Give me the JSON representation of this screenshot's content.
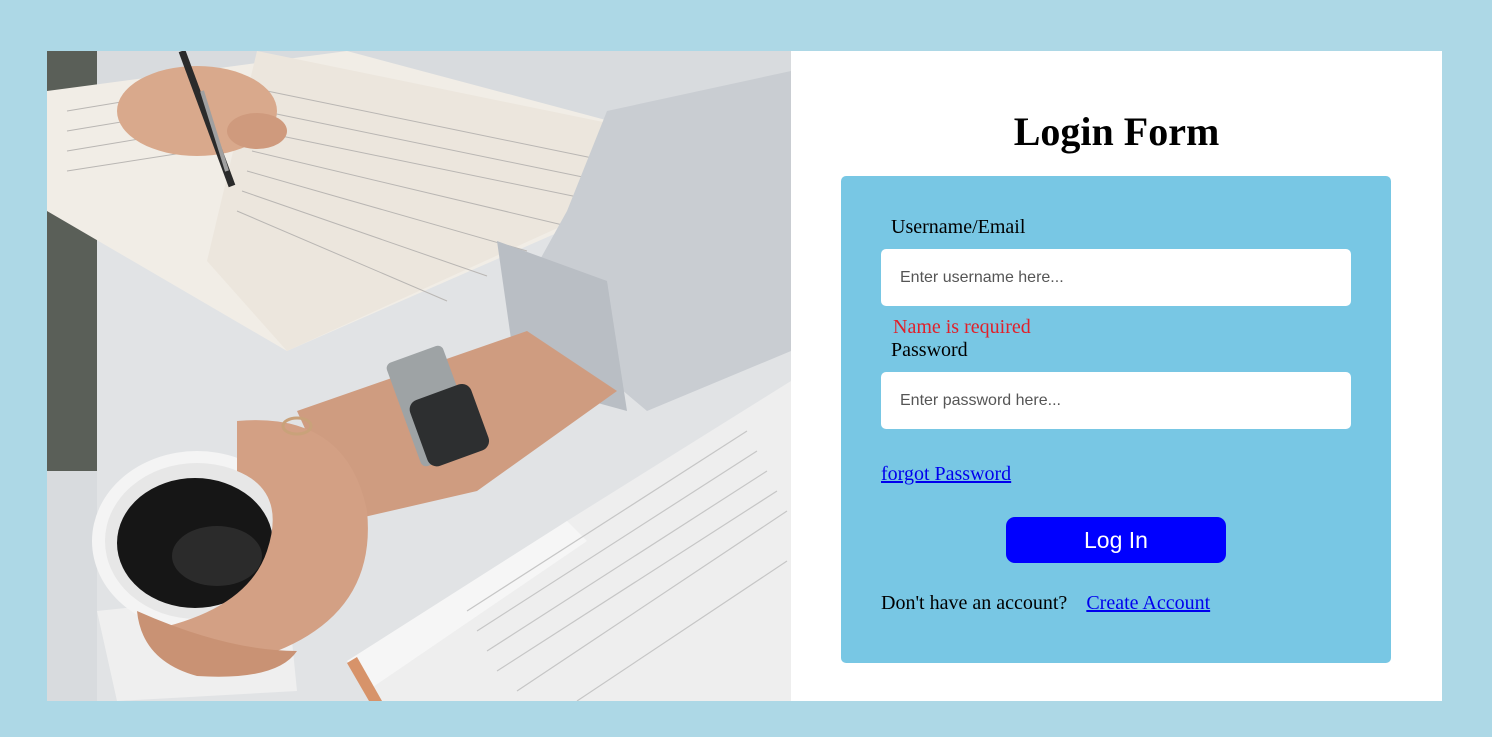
{
  "form": {
    "title": "Login Form",
    "username_label": "Username/Email",
    "username_placeholder": "Enter username here...",
    "username_value": "",
    "username_error": "Name is required",
    "password_label": "Password",
    "password_placeholder": "Enter password here...",
    "password_value": "",
    "forgot_link": "forgot Password",
    "login_button": "Log In",
    "no_account_text": "Don't have an account?",
    "create_account_link": "Create Account"
  },
  "colors": {
    "page_background": "#add8e6",
    "form_box": "#78c7e4",
    "login_button": "#0000ff",
    "error_text": "#e0202a",
    "link": "#0000ee"
  },
  "photo": {
    "icon": "photo-illustration"
  }
}
